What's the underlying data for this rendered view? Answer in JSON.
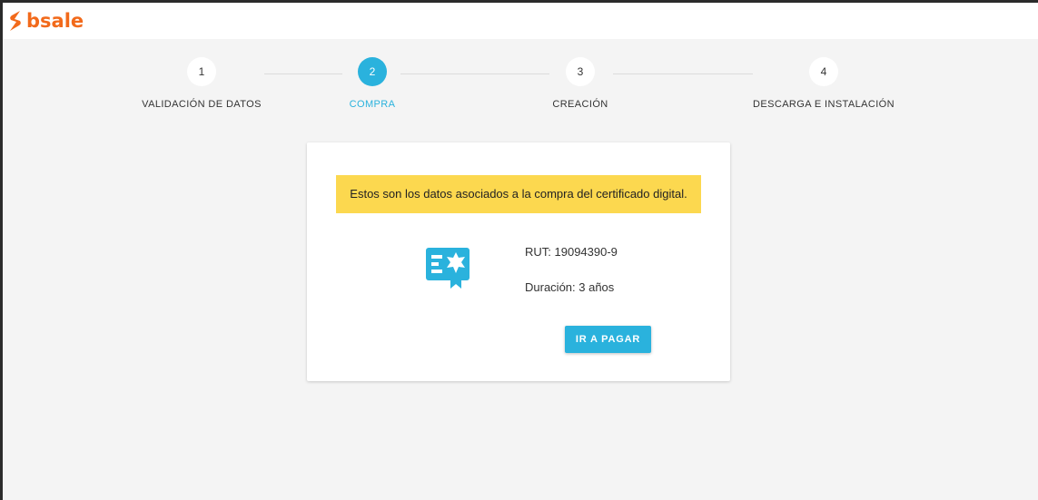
{
  "brand": {
    "name": "bsale",
    "color": "#f26a1b"
  },
  "stepper": {
    "accent": "#2ab2dd",
    "steps": [
      {
        "number": "1",
        "label": "VALIDACIÓN DE DATOS",
        "active": false
      },
      {
        "number": "2",
        "label": "COMPRA",
        "active": true
      },
      {
        "number": "3",
        "label": "CREACIÓN",
        "active": false
      },
      {
        "number": "4",
        "label": "DESCARGA E INSTALACIÓN",
        "active": false
      }
    ]
  },
  "card": {
    "notice": "Estos son los datos asociados a la compra del certificado digital.",
    "notice_color": "#fcd84f",
    "icon": "certificate-icon",
    "rut": "RUT: 19094390-9",
    "duration": "Duración: 3 años",
    "pay_button": "IR A PAGAR"
  }
}
